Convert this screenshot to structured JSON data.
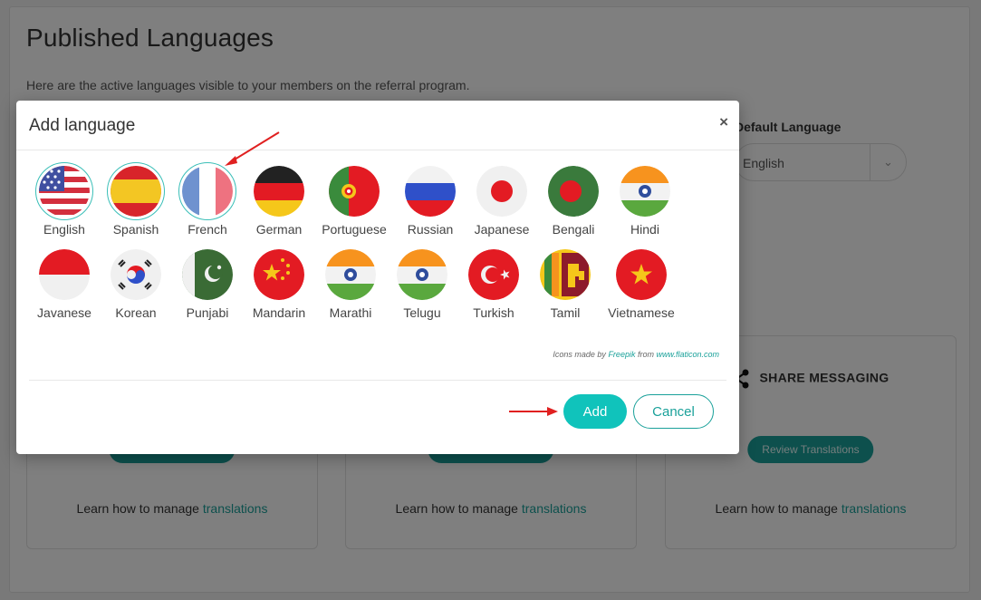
{
  "page": {
    "title": "Published Languages",
    "subtitle": "Here are the active languages visible to your members on the referral program.",
    "default_language_label": "Default Language",
    "default_language_value": "English"
  },
  "cards": [
    {
      "title": "",
      "button": "Review Translations",
      "learn_prefix": "Learn how to manage ",
      "learn_link": "translations"
    },
    {
      "title": "",
      "button": "Review Translations",
      "learn_prefix": "Learn how to manage ",
      "learn_link": "translations"
    },
    {
      "title": "SHARE MESSAGING",
      "button": "Review Translations",
      "learn_prefix": "Learn how to manage ",
      "learn_link": "translations"
    }
  ],
  "modal": {
    "title": "Add language",
    "close": "×",
    "languages": [
      {
        "name": "English",
        "selected": true
      },
      {
        "name": "Spanish",
        "selected": true
      },
      {
        "name": "French",
        "selected": true
      },
      {
        "name": "German",
        "selected": false
      },
      {
        "name": "Portuguese",
        "selected": false
      },
      {
        "name": "Russian",
        "selected": false
      },
      {
        "name": "Japanese",
        "selected": false
      },
      {
        "name": "Bengali",
        "selected": false
      },
      {
        "name": "Hindi",
        "selected": false
      },
      {
        "name": "Javanese",
        "selected": false
      },
      {
        "name": "Korean",
        "selected": false
      },
      {
        "name": "Punjabi",
        "selected": false
      },
      {
        "name": "Mandarin",
        "selected": false
      },
      {
        "name": "Marathi",
        "selected": false
      },
      {
        "name": "Telugu",
        "selected": false
      },
      {
        "name": "Turkish",
        "selected": false
      },
      {
        "name": "Tamil",
        "selected": false
      },
      {
        "name": "Vietnamese",
        "selected": false
      }
    ],
    "credit": {
      "prefix": "Icons made by ",
      "author": "Freepik",
      "middle": " from ",
      "site": "www.flaticon.com"
    },
    "add_label": "Add",
    "cancel_label": "Cancel"
  },
  "colors": {
    "accent": "#10c3bb",
    "accent_dark": "#1aa19a",
    "annotation_arrow": "#e02020"
  }
}
